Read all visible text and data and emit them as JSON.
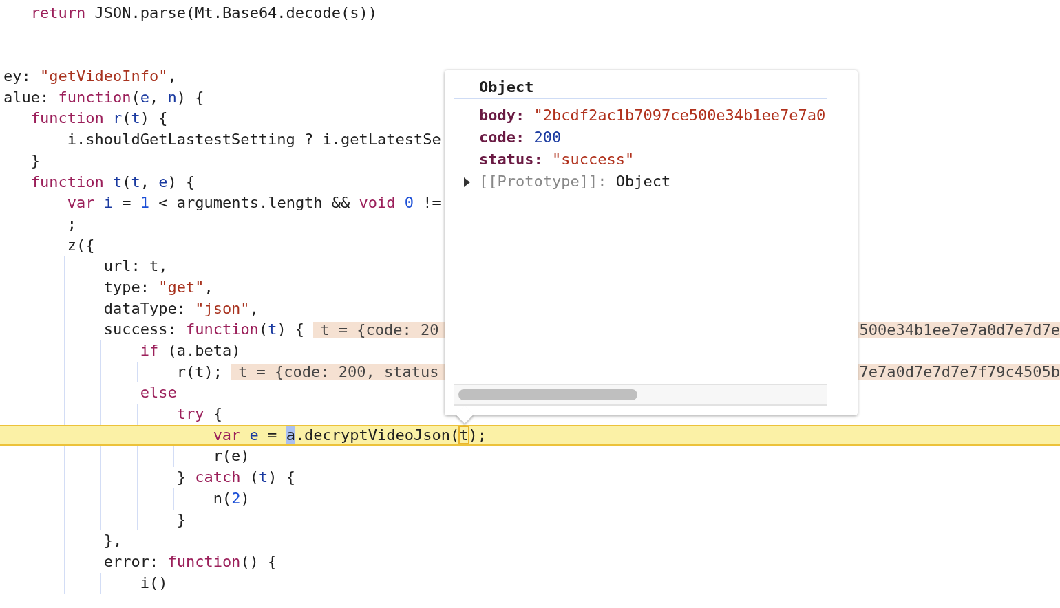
{
  "editor": {
    "lines": [
      {
        "children": [
          {
            "current": false,
            "tokens": [
              {
                "kind": "kw",
                "text": "return"
              },
              {
                "kind": "plain",
                "text": " JSON.parse(Mt.Base64.decode(s))"
              }
            ]
          }
        ]
      },
      {
        "current": false,
        "tokens": [
          {
            "kind": "plain",
            "text": "ey: "
          },
          {
            "kind": "str",
            "text": "\"getVideoInfo\""
          },
          {
            "kind": "plain",
            "text": ","
          }
        ]
      },
      {
        "current": false,
        "tokens": [
          {
            "kind": "plain",
            "text": "alue: "
          },
          {
            "kind": "kw",
            "text": "function"
          },
          {
            "kind": "plain",
            "text": "("
          },
          {
            "kind": "var",
            "text": "e"
          },
          {
            "kind": "plain",
            "text": ", "
          },
          {
            "kind": "var",
            "text": "n"
          },
          {
            "kind": "plain",
            "text": ") {"
          }
        ],
        "children": [
          {
            "current": false,
            "tokens": [
              {
                "kind": "kw",
                "text": "function"
              },
              {
                "kind": "var",
                "text": " r"
              },
              {
                "kind": "plain",
                "text": "("
              },
              {
                "kind": "var",
                "text": "t"
              },
              {
                "kind": "plain",
                "text": ") {"
              }
            ],
            "children": [
              {
                "current": false,
                "tokens": [
                  {
                    "kind": "plain",
                    "text": "i.shouldGetLastestSetting ? i.getLatestSe"
                  }
                ]
              }
            ]
          },
          {
            "current": false,
            "tokens": [
              {
                "kind": "plain",
                "text": "}"
              }
            ]
          },
          {
            "current": false,
            "tokens": [
              {
                "kind": "kw",
                "text": "function"
              },
              {
                "kind": "var",
                "text": " t"
              },
              {
                "kind": "plain",
                "text": "("
              },
              {
                "kind": "var",
                "text": "t"
              },
              {
                "kind": "plain",
                "text": ", "
              },
              {
                "kind": "var",
                "text": "e"
              },
              {
                "kind": "plain",
                "text": ") {"
              }
            ],
            "children": [
              {
                "current": false,
                "tokens": [
                  {
                    "kind": "kw",
                    "text": "var"
                  },
                  {
                    "kind": "var",
                    "text": " i"
                  },
                  {
                    "kind": "plain",
                    "text": " = "
                  },
                  {
                    "kind": "num",
                    "text": "1"
                  },
                  {
                    "kind": "plain",
                    "text": " < arguments.length && "
                  },
                  {
                    "kind": "kw",
                    "text": "void"
                  },
                  {
                    "kind": "num",
                    "text": " 0"
                  },
                  {
                    "kind": "plain",
                    "text": " !="
                  }
                ]
              },
              {
                "current": false,
                "tokens": [
                  {
                    "kind": "plain",
                    "text": ";"
                  }
                ]
              },
              {
                "current": false,
                "tokens": [
                  {
                    "kind": "plain",
                    "text": "z({"
                  }
                ],
                "children": [
                  {
                    "current": false,
                    "tokens": [
                      {
                        "kind": "plain",
                        "text": "url: t,"
                      }
                    ]
                  },
                  {
                    "current": false,
                    "tokens": [
                      {
                        "kind": "plain",
                        "text": "type: "
                      },
                      {
                        "kind": "str",
                        "text": "\"get\""
                      },
                      {
                        "kind": "plain",
                        "text": ","
                      }
                    ]
                  },
                  {
                    "current": false,
                    "tokens": [
                      {
                        "kind": "plain",
                        "text": "dataType: "
                      },
                      {
                        "kind": "str",
                        "text": "\"json\""
                      },
                      {
                        "kind": "plain",
                        "text": ","
                      }
                    ]
                  },
                  {
                    "current": false,
                    "tokens": [
                      {
                        "kind": "plain",
                        "text": "success: "
                      },
                      {
                        "kind": "kw",
                        "text": "function"
                      },
                      {
                        "kind": "plain",
                        "text": "("
                      },
                      {
                        "kind": "var",
                        "text": "t"
                      },
                      {
                        "kind": "plain",
                        "text": ") {"
                      }
                    ],
                    "inline_value": {
                      "start": "t = {code: 20",
                      "end": "500e34b1ee7e7a0d7e7d7e"
                    },
                    "children": [
                      {
                        "current": false,
                        "tokens": [
                          {
                            "kind": "kw",
                            "text": "if"
                          },
                          {
                            "kind": "plain",
                            "text": " (a.beta)"
                          }
                        ],
                        "children": [
                          {
                            "current": false,
                            "tokens": [
                              {
                                "kind": "plain",
                                "text": "r(t);"
                              }
                            ],
                            "inline_value": {
                              "start": "t = {code: 200, status",
                              "end": "7e7a0d7e7d7e7f79c4505b"
                            }
                          }
                        ]
                      },
                      {
                        "current": false,
                        "tokens": [
                          {
                            "kind": "kw",
                            "text": "else"
                          }
                        ],
                        "children": [
                          {
                            "current": false,
                            "tokens": [
                              {
                                "kind": "kw",
                                "text": "try"
                              },
                              {
                                "kind": "plain",
                                "text": " {"
                              }
                            ],
                            "children": [
                              {
                                "current": true,
                                "tokens": [
                                  {
                                    "kind": "kw",
                                    "text": "var"
                                  },
                                  {
                                    "kind": "var",
                                    "text": " e"
                                  },
                                  {
                                    "kind": "plain",
                                    "text": " = "
                                  },
                                  {
                                    "kind": "selected",
                                    "text": "a"
                                  },
                                  {
                                    "kind": "plain",
                                    "text": ".decryptVideoJson("
                                  },
                                  {
                                    "kind": "boxed",
                                    "text": "t"
                                  },
                                  {
                                    "kind": "plain",
                                    "text": ");"
                                  }
                                ]
                              },
                              {
                                "current": false,
                                "tokens": [
                                  {
                                    "kind": "plain",
                                    "text": "r(e)"
                                  }
                                ]
                              }
                            ]
                          },
                          {
                            "current": false,
                            "tokens": [
                              {
                                "kind": "plain",
                                "text": "} "
                              },
                              {
                                "kind": "kw",
                                "text": "catch"
                              },
                              {
                                "kind": "plain",
                                "text": " ("
                              },
                              {
                                "kind": "var",
                                "text": "t"
                              },
                              {
                                "kind": "plain",
                                "text": ") {"
                              }
                            ],
                            "children": [
                              {
                                "current": false,
                                "tokens": [
                                  {
                                    "kind": "plain",
                                    "text": "n("
                                  },
                                  {
                                    "kind": "num",
                                    "text": "2"
                                  },
                                  {
                                    "kind": "plain",
                                    "text": ")"
                                  }
                                ]
                              }
                            ]
                          },
                          {
                            "current": false,
                            "tokens": [
                              {
                                "kind": "plain",
                                "text": "}"
                              }
                            ]
                          }
                        ]
                      }
                    ]
                  },
                  {
                    "current": false,
                    "tokens": [
                      {
                        "kind": "plain",
                        "text": "},"
                      }
                    ]
                  },
                  {
                    "current": false,
                    "tokens": [
                      {
                        "kind": "plain",
                        "text": "error: "
                      },
                      {
                        "kind": "kw",
                        "text": "function"
                      },
                      {
                        "kind": "plain",
                        "text": "() {"
                      }
                    ],
                    "children": [
                      {
                        "current": false,
                        "tokens": [
                          {
                            "kind": "plain",
                            "text": "i()"
                          }
                        ]
                      }
                    ]
                  }
                ]
              }
            ]
          }
        ]
      }
    ]
  },
  "popover": {
    "title": "Object",
    "properties": [
      {
        "kind": "field",
        "key": "body:",
        "value": "\"2bcdf2ac1b7097ce500e34b1ee7e7a0",
        "color": "#b0311c"
      },
      {
        "kind": "field",
        "key": "code:",
        "value": "200",
        "color": "#1a3aa0"
      },
      {
        "kind": "field",
        "key": "status:",
        "value": "\"success\"",
        "color": "#b0311c"
      },
      {
        "kind": "prototype",
        "key": "[[Prototype]]:",
        "value": "Object",
        "color": "#1f1f1f",
        "expanded": false
      }
    ]
  }
}
